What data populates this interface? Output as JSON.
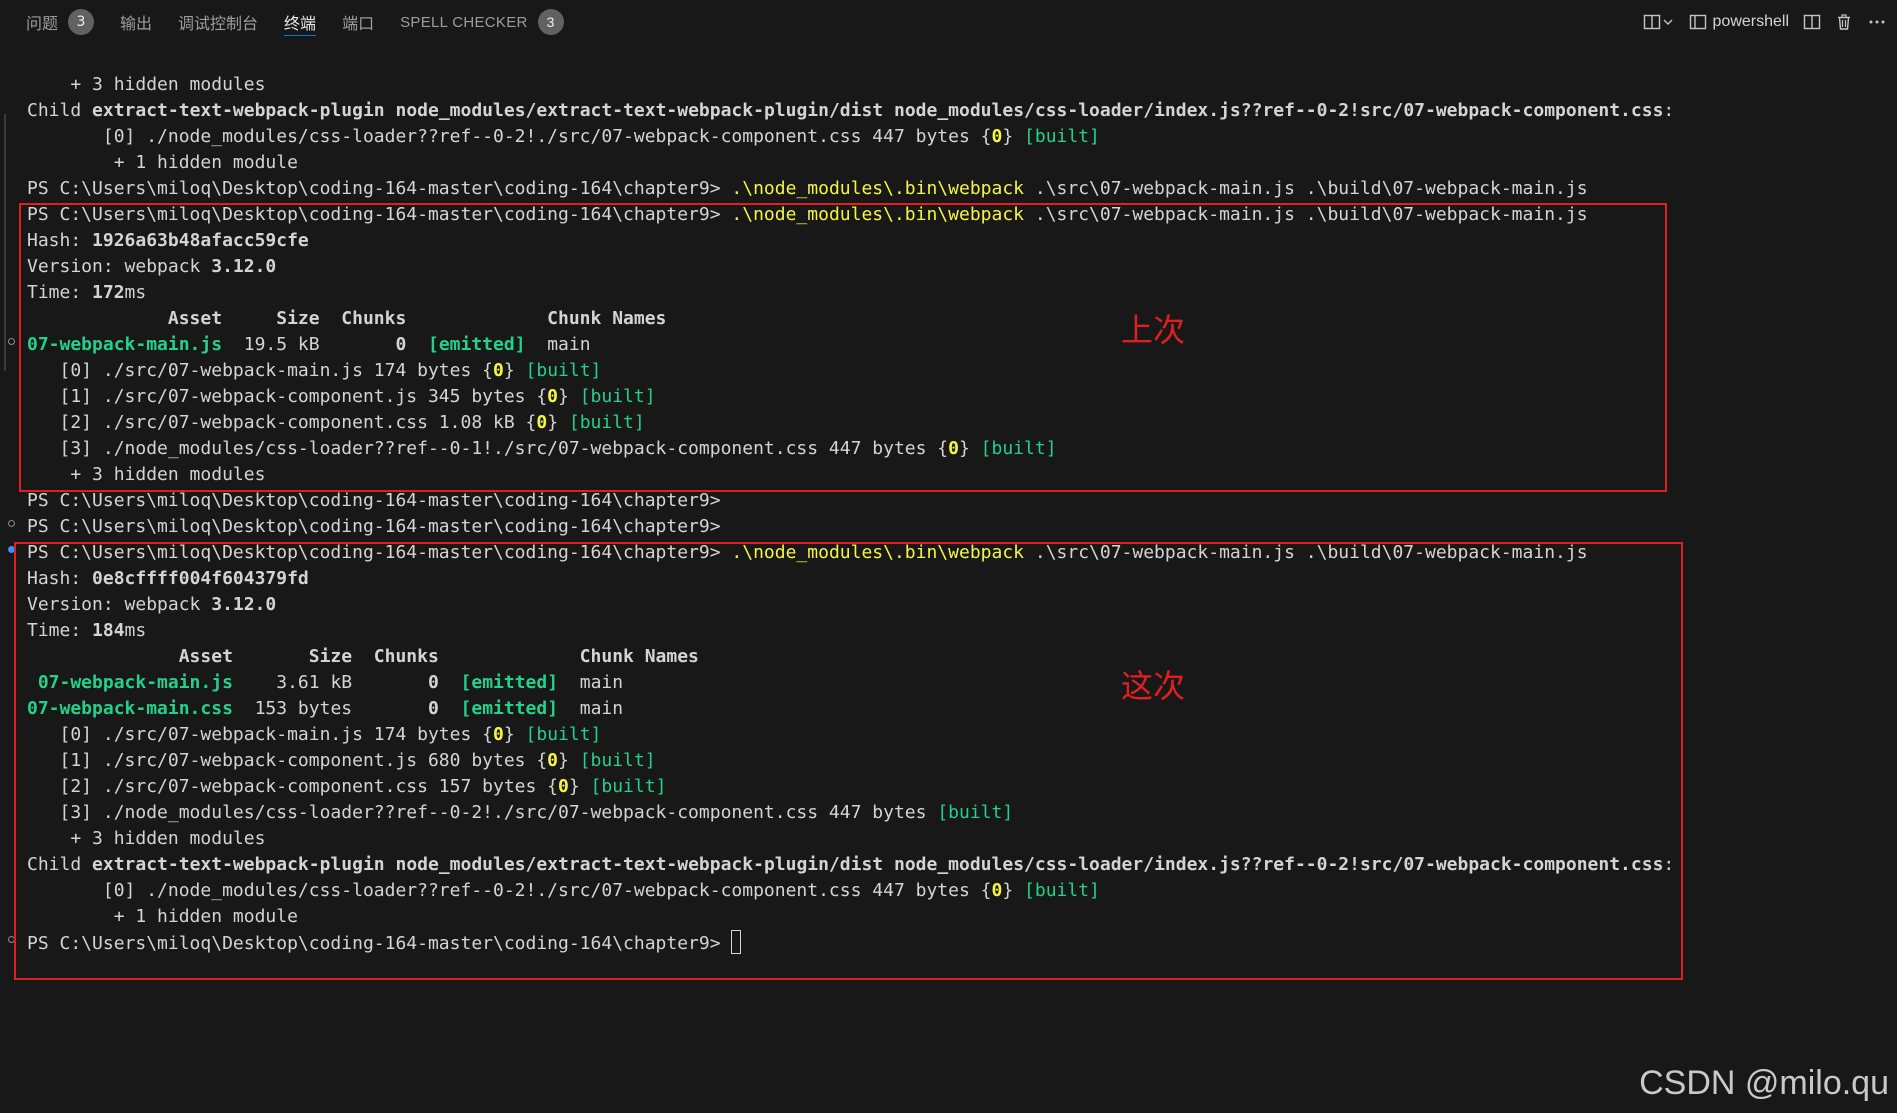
{
  "tabs": [
    {
      "label": "问题",
      "badge": "3"
    },
    {
      "label": "输出"
    },
    {
      "label": "调试控制台"
    },
    {
      "label": "终端",
      "active": true
    },
    {
      "label": "端口"
    },
    {
      "label": "SPELL CHECKER",
      "badge": "3"
    }
  ],
  "actions": {
    "shell_label": "powershell"
  },
  "terminal": {
    "lines": [
      [
        {
          "t": "    + 3 hidden modules"
        }
      ],
      [
        {
          "t": "Child "
        },
        {
          "t": "extract-text-webpack-plugin",
          "c": "b"
        },
        {
          "t": " "
        },
        {
          "t": "node_modules/extract-text-webpack-plugin/dist node_modules/css-loader/index.js??ref--0-2!src/07-webpack-component.css",
          "c": "b"
        },
        {
          "t": ":"
        }
      ],
      [
        {
          "t": "       [0] ./node_modules/css-loader??ref--0-2!./src/07-webpack-component.css 447 bytes {"
        },
        {
          "t": "0",
          "c": "yb"
        },
        {
          "t": "} "
        },
        {
          "t": "[built]",
          "c": "g"
        }
      ],
      [
        {
          "t": "        + 1 hidden module"
        }
      ],
      [
        {
          "t": "PS C:\\Users\\miloq\\Desktop\\coding-164-master\\coding-164\\chapter9> "
        },
        {
          "t": ".\\node_modules\\.bin\\webpack",
          "c": "y"
        },
        {
          "t": " .\\src\\07-webpack-main.js .\\build\\07-webpack-main.js"
        }
      ],
      [
        {
          "t": "PS C:\\Users\\miloq\\Desktop\\coding-164-master\\coding-164\\chapter9> "
        },
        {
          "t": ".\\node_modules\\.bin\\webpack",
          "c": "y"
        },
        {
          "t": " .\\src\\07-webpack-main.js .\\build\\07-webpack-main.js"
        }
      ],
      [
        {
          "t": "Hash: "
        },
        {
          "t": "1926a63b48afacc59cfe",
          "c": "b"
        }
      ],
      [
        {
          "t": "Version: webpack "
        },
        {
          "t": "3.12.0",
          "c": "b"
        }
      ],
      [
        {
          "t": "Time: "
        },
        {
          "t": "172",
          "c": "b"
        },
        {
          "t": "ms"
        }
      ],
      [
        {
          "t": "             Asset     Size  Chunks             Chunk Names",
          "c": "b"
        }
      ],
      [
        {
          "t": "07-webpack-main.js",
          "c": "gb"
        },
        {
          "t": "  19.5 kB       "
        },
        {
          "t": "0",
          "c": "b"
        },
        {
          "t": "  "
        },
        {
          "t": "[emitted]",
          "c": "gb"
        },
        {
          "t": "  main"
        }
      ],
      [
        {
          "t": "   [0] ./src/07-webpack-main.js 174 bytes {"
        },
        {
          "t": "0",
          "c": "yb"
        },
        {
          "t": "} "
        },
        {
          "t": "[built]",
          "c": "g"
        }
      ],
      [
        {
          "t": "   [1] ./src/07-webpack-component.js 345 bytes {"
        },
        {
          "t": "0",
          "c": "yb"
        },
        {
          "t": "} "
        },
        {
          "t": "[built]",
          "c": "g"
        }
      ],
      [
        {
          "t": "   [2] ./src/07-webpack-component.css 1.08 kB {"
        },
        {
          "t": "0",
          "c": "yb"
        },
        {
          "t": "} "
        },
        {
          "t": "[built]",
          "c": "g"
        }
      ],
      [
        {
          "t": "   [3] ./node_modules/css-loader??ref--0-1!./src/07-webpack-component.css 447 bytes {"
        },
        {
          "t": "0",
          "c": "yb"
        },
        {
          "t": "} "
        },
        {
          "t": "[built]",
          "c": "g"
        }
      ],
      [
        {
          "t": "    + 3 hidden modules"
        }
      ],
      [
        {
          "t": "PS C:\\Users\\miloq\\Desktop\\coding-164-master\\coding-164\\chapter9>"
        }
      ],
      [
        {
          "t": "PS C:\\Users\\miloq\\Desktop\\coding-164-master\\coding-164\\chapter9>"
        }
      ],
      [
        {
          "t": "PS C:\\Users\\miloq\\Desktop\\coding-164-master\\coding-164\\chapter9> "
        },
        {
          "t": ".\\node_modules\\.bin\\webpack",
          "c": "y"
        },
        {
          "t": " .\\src\\07-webpack-main.js .\\build\\07-webpack-main.js"
        }
      ],
      [
        {
          "t": "Hash: "
        },
        {
          "t": "0e8cffff004f604379fd",
          "c": "b"
        }
      ],
      [
        {
          "t": "Version: webpack "
        },
        {
          "t": "3.12.0",
          "c": "b"
        }
      ],
      [
        {
          "t": "Time: "
        },
        {
          "t": "184",
          "c": "b"
        },
        {
          "t": "ms"
        }
      ],
      [
        {
          "t": "              Asset       Size  Chunks             Chunk Names",
          "c": "b"
        }
      ],
      [
        {
          "t": " 07-webpack-main.js",
          "c": "gb"
        },
        {
          "t": "    3.61 kB       "
        },
        {
          "t": "0",
          "c": "b"
        },
        {
          "t": "  "
        },
        {
          "t": "[emitted]",
          "c": "gb"
        },
        {
          "t": "  main"
        }
      ],
      [
        {
          "t": "07-webpack-main.css",
          "c": "gb"
        },
        {
          "t": "  153 bytes       "
        },
        {
          "t": "0",
          "c": "b"
        },
        {
          "t": "  "
        },
        {
          "t": "[emitted]",
          "c": "gb"
        },
        {
          "t": "  main"
        }
      ],
      [
        {
          "t": "   [0] ./src/07-webpack-main.js 174 bytes {"
        },
        {
          "t": "0",
          "c": "yb"
        },
        {
          "t": "} "
        },
        {
          "t": "[built]",
          "c": "g"
        }
      ],
      [
        {
          "t": "   [1] ./src/07-webpack-component.js 680 bytes {"
        },
        {
          "t": "0",
          "c": "yb"
        },
        {
          "t": "} "
        },
        {
          "t": "[built]",
          "c": "g"
        }
      ],
      [
        {
          "t": "   [2] ./src/07-webpack-component.css 157 bytes {"
        },
        {
          "t": "0",
          "c": "yb"
        },
        {
          "t": "} "
        },
        {
          "t": "[built]",
          "c": "g"
        }
      ],
      [
        {
          "t": "   [3] ./node_modules/css-loader??ref--0-2!./src/07-webpack-component.css 447 bytes "
        },
        {
          "t": "[built]",
          "c": "g"
        }
      ],
      [
        {
          "t": "    + 3 hidden modules"
        }
      ],
      [
        {
          "t": "Child "
        },
        {
          "t": "extract-text-webpack-plugin",
          "c": "b"
        },
        {
          "t": " "
        },
        {
          "t": "node_modules/extract-text-webpack-plugin/dist node_modules/css-loader/index.js??ref--0-2!src/07-webpack-component.css",
          "c": "b"
        },
        {
          "t": ":"
        }
      ],
      [
        {
          "t": "       [0] ./node_modules/css-loader??ref--0-2!./src/07-webpack-component.css 447 bytes {"
        },
        {
          "t": "0",
          "c": "yb"
        },
        {
          "t": "} "
        },
        {
          "t": "[built]",
          "c": "g"
        }
      ],
      [
        {
          "t": "        + 1 hidden module"
        }
      ],
      [
        {
          "t": "PS C:\\Users\\miloq\\Desktop\\coding-164-master\\coding-164\\chapter9> "
        },
        {
          "cursor": true
        }
      ]
    ]
  },
  "annotations": {
    "previous_label": "上次",
    "current_label": "这次"
  },
  "watermark": "CSDN @milo.qu",
  "colors": {
    "background": "#181818",
    "text": "#d4d4d4",
    "yellow": "#f5f543",
    "green": "#23d18b",
    "annotation_red": "#e02020",
    "active_tab_underline": "#0078d4"
  }
}
